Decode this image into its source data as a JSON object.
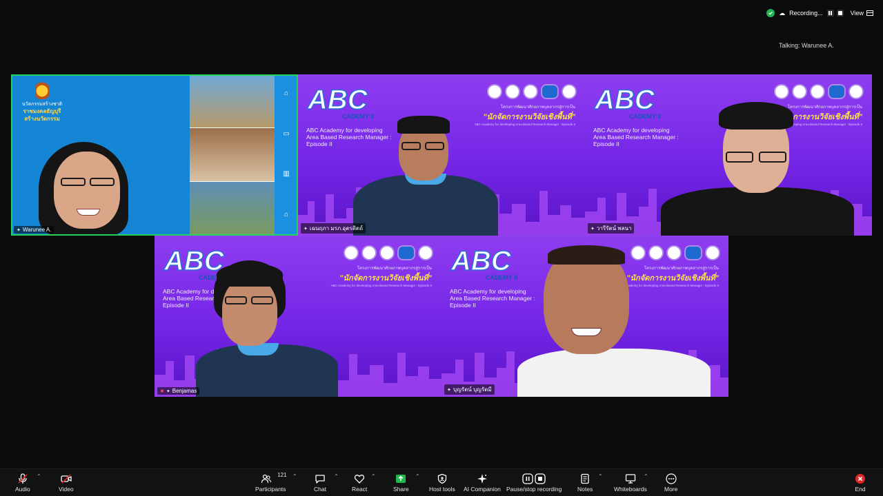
{
  "status": {
    "recording_label": "Recording...",
    "view_label": "View",
    "talking": "Talking: Warunee A."
  },
  "tiles": [
    {
      "name": "Warunee A.",
      "org_lines": [
        "นวัตกรรมสร้างชาติ",
        "ราชมงคลธัญบุรี",
        "สร้างนวัตกรรม"
      ]
    },
    {
      "name": "เฉนฤภา มรภ.อุตรดิตถ์"
    },
    {
      "name": "วารีรัตน์ พลนา"
    },
    {
      "name": "Benjamas"
    },
    {
      "name": "บุญรัตน์ บุญรัตมี"
    }
  ],
  "background": {
    "abc_lines": [
      "ABC Academy for developing",
      "Area Based Research Manager :",
      "Episode II"
    ],
    "thai_sub": "โครงการพัฒนาศักยภาพบุคลากรสู่การเป็น",
    "thai_title": "\"นักจัดการงานวิจัยเชิงพื้นที่\"",
    "en_sub": "ABC Academy for developing Area Based Research Manager : Episode II"
  },
  "toolbar": {
    "audio": "Audio",
    "video": "Video",
    "participants": "Participants",
    "participants_count": "121",
    "chat": "Chat",
    "react": "React",
    "share": "Share",
    "host_tools": "Host tools",
    "ai_companion": "AI Companion",
    "pause_recording": "Pause/stop recording",
    "notes": "Notes",
    "whiteboards": "Whiteboards",
    "more": "More",
    "end": "End"
  },
  "colors": {
    "active_speaker": "#23d35a",
    "share_green": "#1fb84e",
    "end_red": "#e02828",
    "tile_purple": "#7b2ff0"
  }
}
